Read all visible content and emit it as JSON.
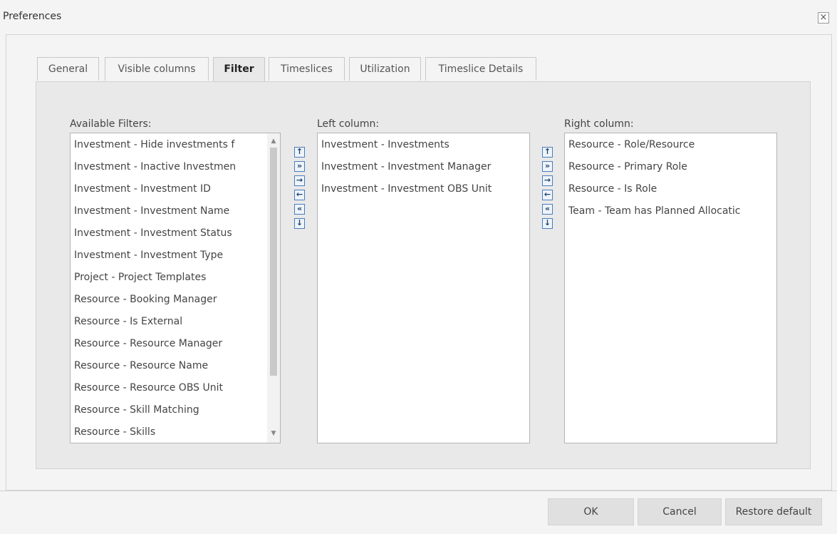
{
  "dialog": {
    "title": "Preferences",
    "close_glyph": "×"
  },
  "tabs": [
    {
      "label": "General"
    },
    {
      "label": "Visible columns"
    },
    {
      "label": "Filter",
      "active": true
    },
    {
      "label": "Timeslices"
    },
    {
      "label": "Utilization"
    },
    {
      "label": "Timeslice Details"
    }
  ],
  "available": {
    "label": "Available Filters:",
    "items": [
      "Investment - Hide investments f",
      "Investment - Inactive Investmen",
      "Investment - Investment ID",
      "Investment - Investment Name",
      "Investment - Investment Status",
      "Investment - Investment Type",
      "Project - Project Templates",
      "Resource - Booking Manager",
      "Resource - Is External",
      "Resource - Resource Manager",
      "Resource - Resource Name",
      "Resource - Resource OBS Unit",
      "Resource - Skill Matching",
      "Resource - Skills"
    ],
    "scroll_up_glyph": "▲",
    "scroll_down_glyph": "▼"
  },
  "left_column": {
    "label": "Left column:",
    "items": [
      "Investment - Investments",
      "Investment - Investment Manager",
      "Investment - Investment OBS Unit"
    ]
  },
  "right_column": {
    "label": "Right column:",
    "items": [
      "Resource - Role/Resource",
      "Resource - Primary Role",
      "Resource - Is Role",
      "Team - Team has Planned Allocatic"
    ]
  },
  "move_buttons": {
    "up": "↑",
    "add_all": "»",
    "add": "→",
    "remove": "←",
    "remove_all": "«",
    "down": "↓"
  },
  "footer": {
    "ok": "OK",
    "cancel": "Cancel",
    "restore": "Restore default"
  },
  "colors": {
    "panel_bg": "#e9e9e9",
    "button_border": "#4a7cba"
  }
}
